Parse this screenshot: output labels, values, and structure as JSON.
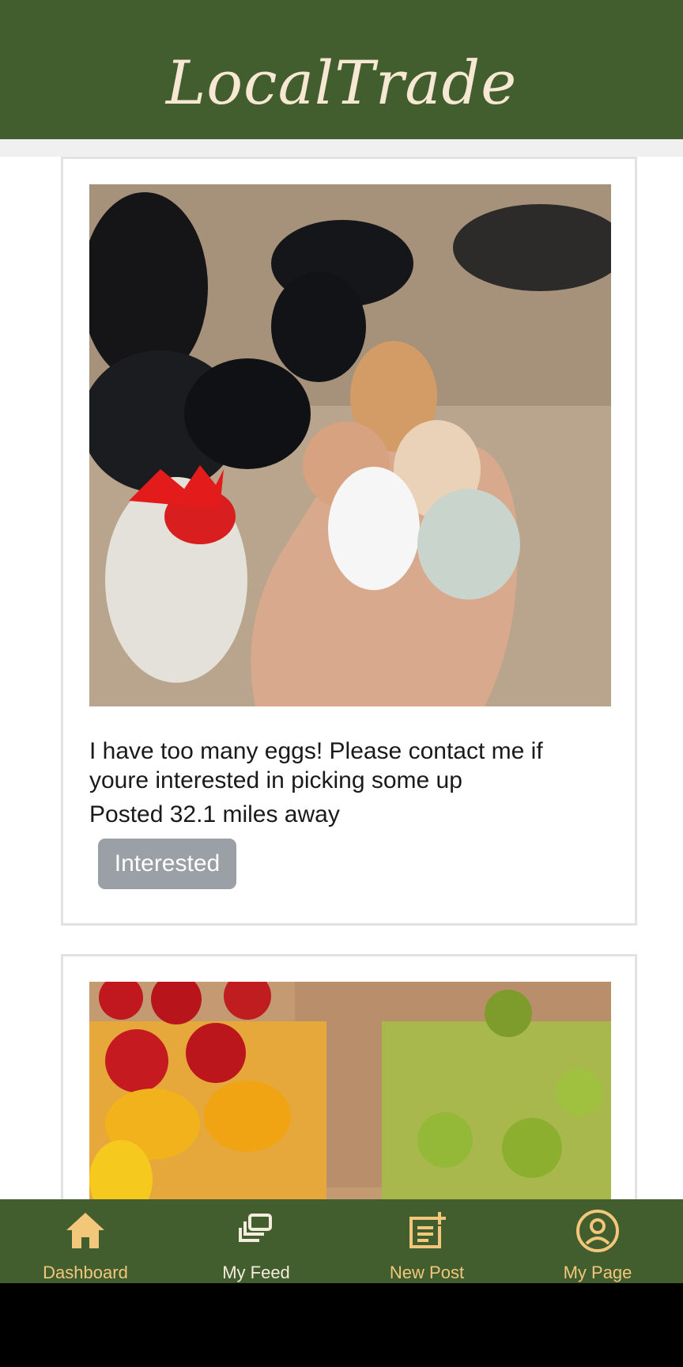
{
  "header": {
    "logo_text": "LocalTrade"
  },
  "feed": {
    "posts": [
      {
        "image_desc": "eggs",
        "text": "I have too many eggs! Please contact me if youre interested in picking some up",
        "distance": "Posted 32.1 miles away",
        "button_label": "Interested"
      },
      {
        "image_desc": "tomatoes"
      }
    ]
  },
  "nav": {
    "items": [
      {
        "label": "Dashboard",
        "icon": "home-icon",
        "active": true
      },
      {
        "label": "My Feed",
        "icon": "feed-icon",
        "active": false
      },
      {
        "label": "New Post",
        "icon": "new-post-icon",
        "active": false
      },
      {
        "label": "My Page",
        "icon": "account-icon",
        "active": false
      }
    ]
  },
  "colors": {
    "brand_green": "#425d2e",
    "cream": "#f6e8d2",
    "accent": "#f2c77a",
    "button_gray": "#9aa0a6"
  }
}
